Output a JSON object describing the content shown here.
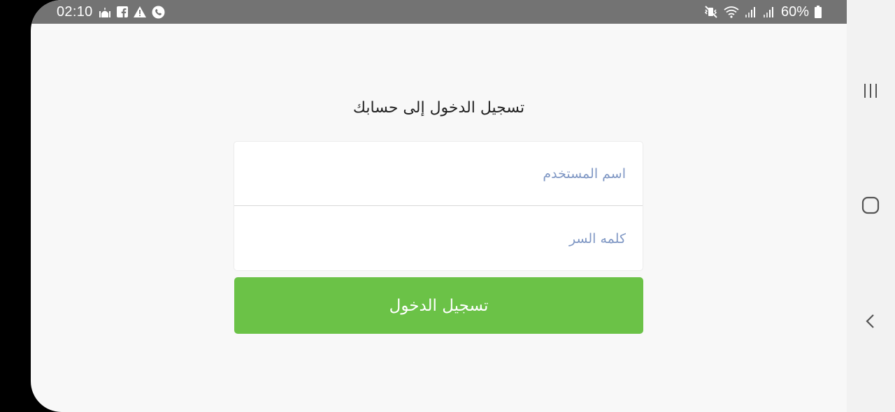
{
  "status_bar": {
    "time": "02:10",
    "battery_percent": "60%",
    "left_icons": [
      "mosque-icon",
      "facebook-icon",
      "warning-icon",
      "whatsapp-icon"
    ],
    "right_icons": [
      "mute-vibrate-icon",
      "wifi-icon",
      "signal-icon",
      "signal-icon",
      "battery-icon"
    ]
  },
  "login": {
    "title": "تسجيل الدخول إلى حسابك",
    "username_placeholder": "اسم المستخدم",
    "password_placeholder": "كلمه السر",
    "submit_label": "تسجيل الدخول"
  },
  "nav_bar": {
    "buttons": [
      "recent-apps-icon",
      "home-icon",
      "back-icon"
    ]
  },
  "colors": {
    "status_bar_bg": "#737373",
    "screen_bg": "#f8f8f8",
    "button_green": "#6bc247",
    "placeholder_blue": "#7f97c4",
    "nav_bar_bg": "#f2f2f2"
  }
}
